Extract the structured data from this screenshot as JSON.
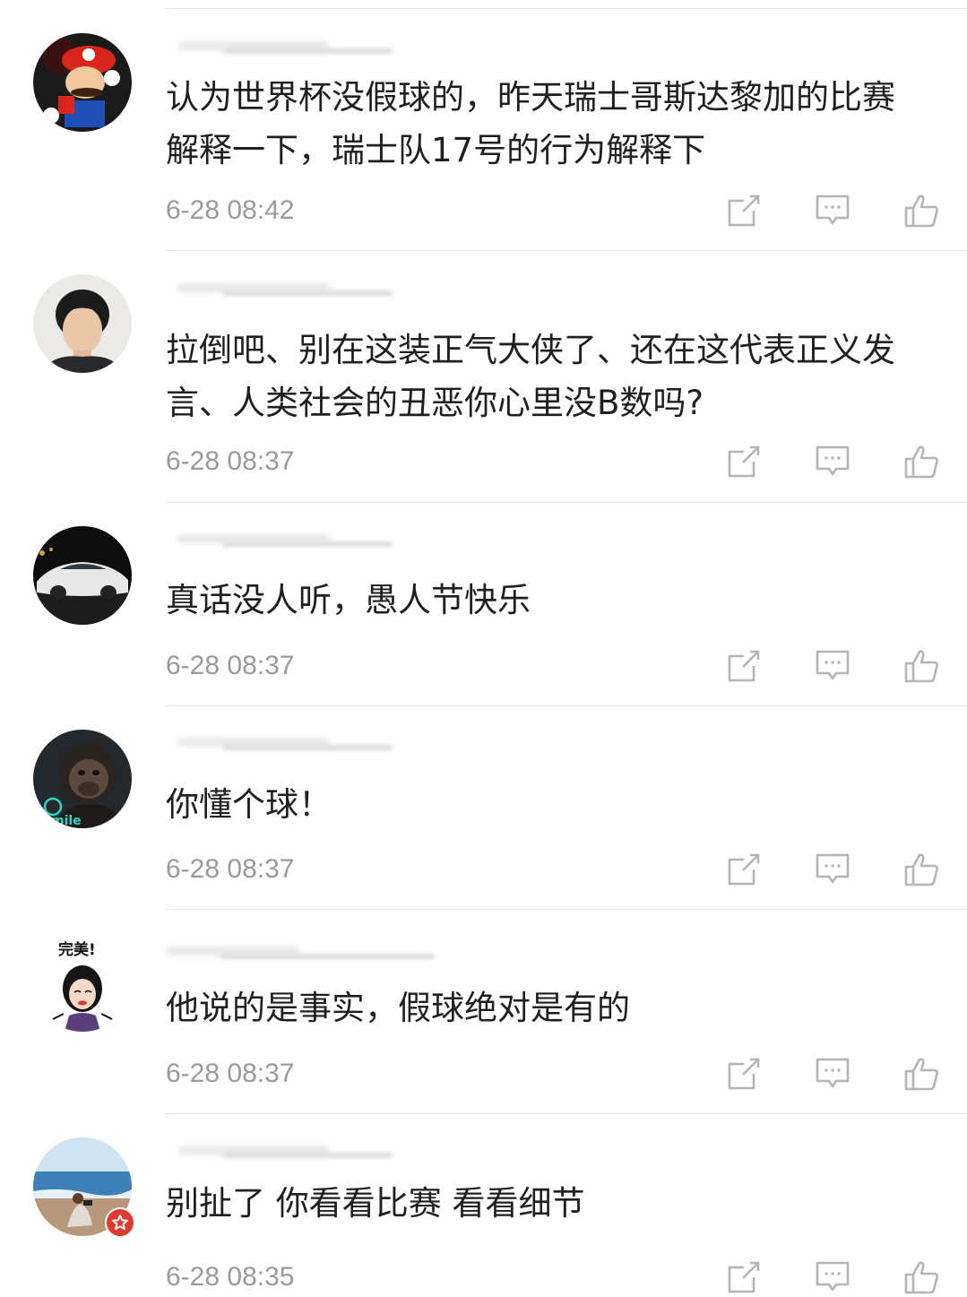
{
  "comments": [
    {
      "avatar": "mario-avatar",
      "text": "认为世界杯没假球的，昨天瑞士哥斯达黎加的比赛\n解释一下，瑞士队17号的行为解释下",
      "time": "6-28 08:42"
    },
    {
      "avatar": "young-man-avatar",
      "text": "拉倒吧、别在这装正气大侠了、还在这代表正义发\n言、人类社会的丑恶你心里没B数吗?",
      "time": "6-28 08:37"
    },
    {
      "avatar": "sports-car-avatar",
      "text": "真话没人听，愚人节快乐",
      "time": "6-28 08:37"
    },
    {
      "avatar": "ape-avatar",
      "avatar_text": "mile",
      "text": "你懂个球！",
      "time": "6-28 08:37"
    },
    {
      "avatar": "cartoon-woman-avatar",
      "avatar_text": "完美!",
      "text": "他说的是事实，假球绝对是有的",
      "time": "6-28 08:37"
    },
    {
      "avatar": "beach-avatar",
      "verified_badge": true,
      "text": "别扯了 你看看比赛 看看细节",
      "time": "6-28 08:35"
    }
  ],
  "actions": {
    "share_icon": "share-icon",
    "reply_icon": "reply-comment-icon",
    "like_icon": "thumbs-up-icon"
  },
  "colors": {
    "text": "#1f1f1f",
    "time": "#9a9a9a",
    "icon": "#b5b5b5",
    "divider": "#e6e6e6",
    "badge": "#e2392f"
  }
}
